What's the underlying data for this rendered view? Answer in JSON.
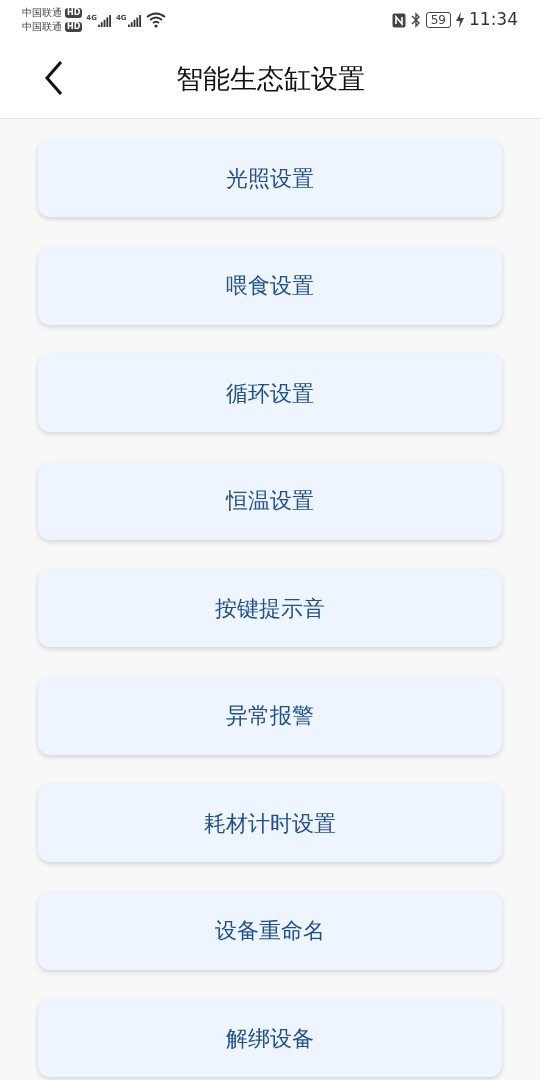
{
  "status_bar": {
    "carriers": [
      {
        "name": "中国联通",
        "badge": "HD"
      },
      {
        "name": "中国联通",
        "badge": "HD"
      }
    ],
    "networks": [
      "4G",
      "4G"
    ],
    "battery": "59",
    "time": "11:34"
  },
  "header": {
    "title": "智能生态缸设置"
  },
  "menu": [
    {
      "label": "光照设置"
    },
    {
      "label": "喂食设置"
    },
    {
      "label": "循环设置"
    },
    {
      "label": "恒温设置"
    },
    {
      "label": "按键提示音"
    },
    {
      "label": "异常报警"
    },
    {
      "label": "耗材计时设置"
    },
    {
      "label": "设备重命名"
    },
    {
      "label": "解绑设备"
    }
  ]
}
